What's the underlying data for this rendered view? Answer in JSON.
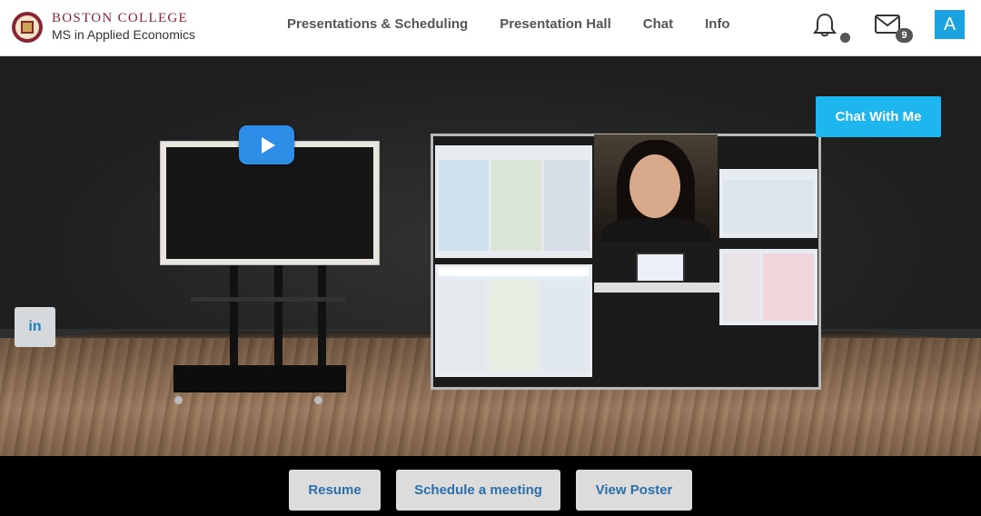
{
  "header": {
    "brand_title": "BOSTON COLLEGE",
    "brand_subtitle": "MS in Applied Economics",
    "nav": [
      {
        "label": "Presentations & Scheduling"
      },
      {
        "label": "Presentation Hall"
      },
      {
        "label": "Chat"
      },
      {
        "label": "Info"
      }
    ],
    "mail_count": "9",
    "avatar_letter": "A",
    "icons": {
      "bell": "bell-icon",
      "mail": "envelope-icon"
    }
  },
  "scene": {
    "chat_button": "Chat With Me",
    "linkedin_label": "in",
    "video": "play-icon"
  },
  "actions": {
    "resume": "Resume",
    "schedule": "Schedule a meeting",
    "view_poster": "View Poster"
  },
  "colors": {
    "accent": "#1db6ee",
    "avatar": "#1aa3e0",
    "play": "#2e8de6",
    "brand": "#8a2432"
  }
}
